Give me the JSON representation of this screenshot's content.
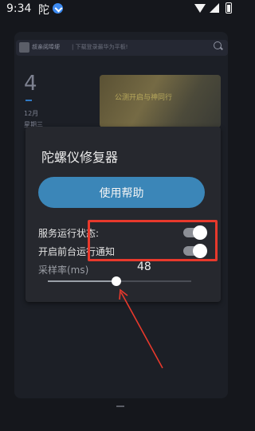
{
  "status_bar": {
    "time": "9:34",
    "app_glyph": "陀",
    "download_icon": "download-icon"
  },
  "background": {
    "header_left_text": "叔亲阅埠埂",
    "header_right_text": "| 下载登录最华为平板!",
    "date_day": "4",
    "date_month": "12月",
    "date_weekday": "星期三",
    "banner_text": "公测开启与神同行"
  },
  "dialog": {
    "title": "陀螺仪修复器",
    "help_button": "使用帮助",
    "service_label": "服务运行状态:",
    "service_on": true,
    "foreground_label": "开启前台运行通知",
    "foreground_on": true,
    "sample_label": "采样率(ms)",
    "sample_value": "48",
    "sample_fraction": 0.48
  },
  "colors": {
    "accent": "#3b86b8",
    "annotation": "#e8392c"
  }
}
